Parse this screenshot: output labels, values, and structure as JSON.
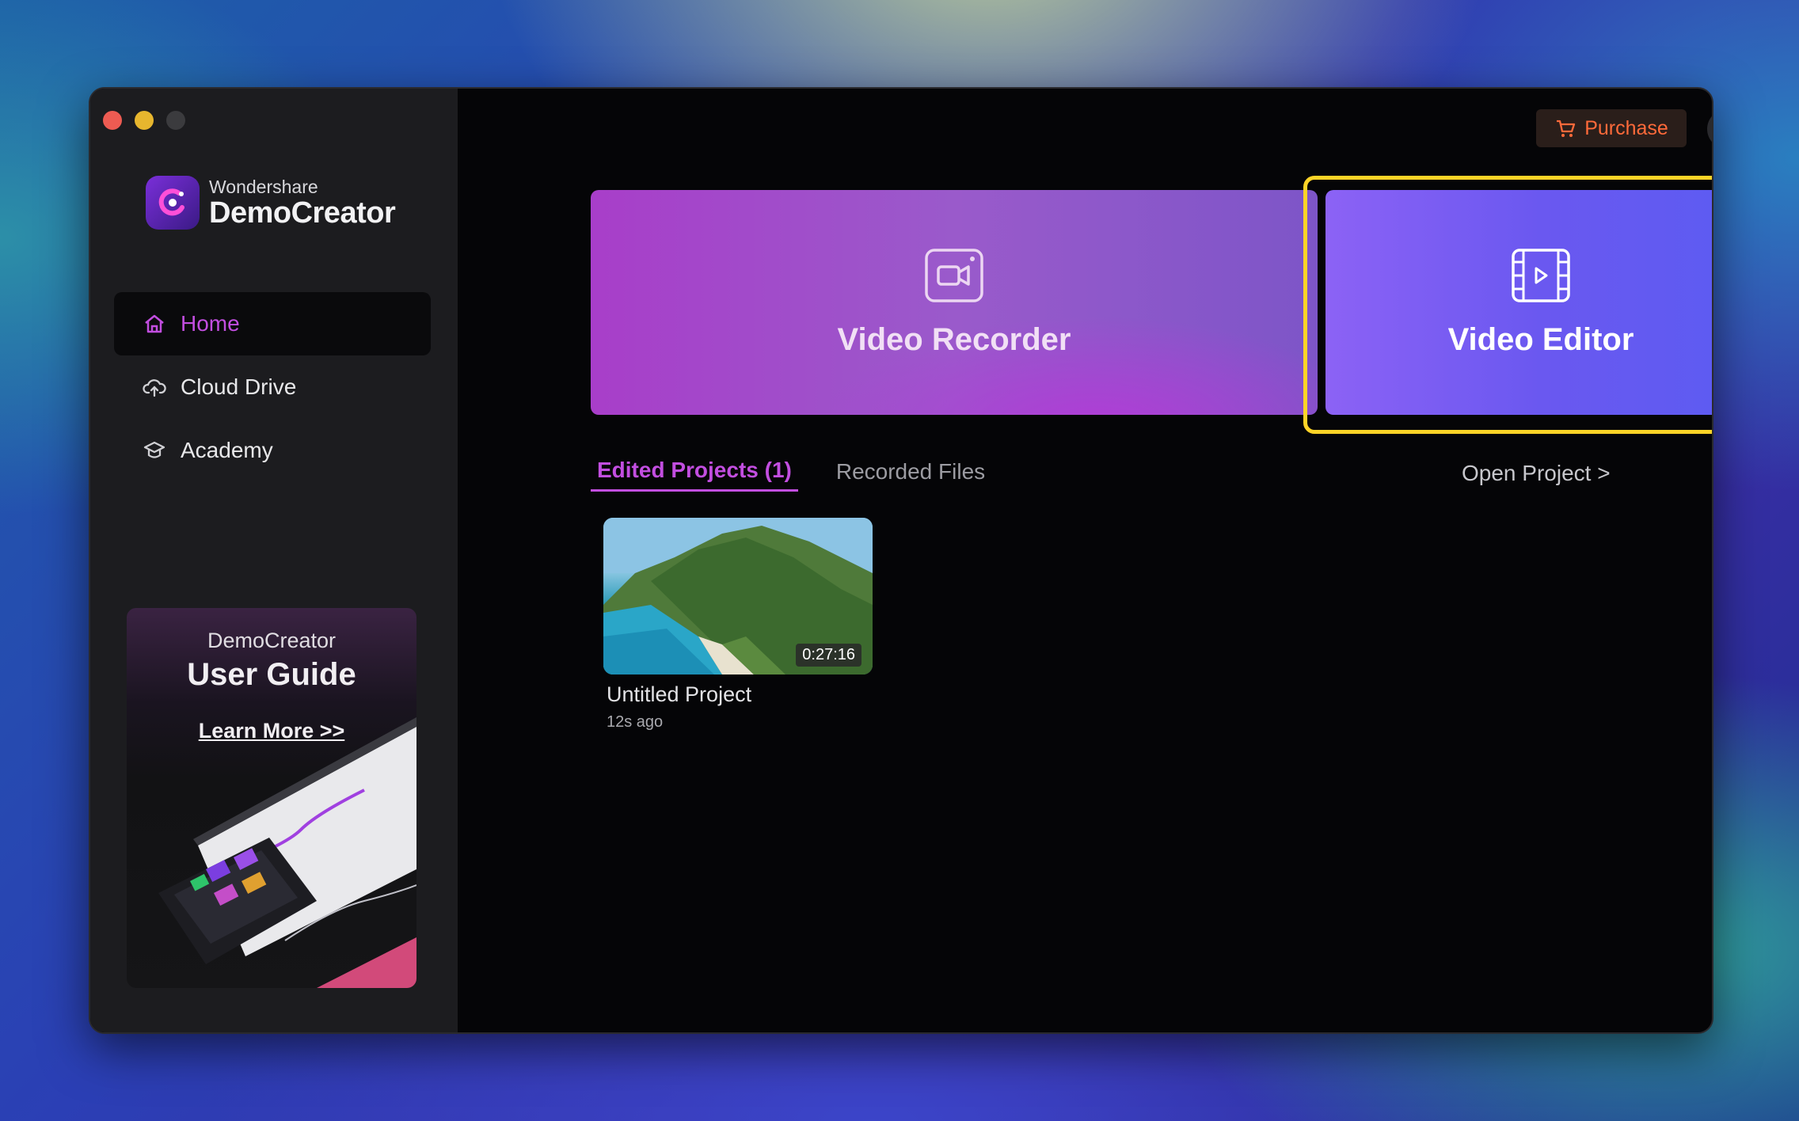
{
  "brand": {
    "company": "Wondershare",
    "product": "DemoCreator"
  },
  "sidebar": {
    "items": [
      {
        "label": "Home",
        "icon": "home-icon",
        "active": true
      },
      {
        "label": "Cloud Drive",
        "icon": "cloud-upload-icon",
        "active": false
      },
      {
        "label": "Academy",
        "icon": "graduation-cap-icon",
        "active": false
      }
    ],
    "guide": {
      "subtitle": "DemoCreator",
      "title": "User Guide",
      "link": "Learn More >>"
    }
  },
  "header": {
    "purchase_label": "Purchase"
  },
  "cards": {
    "recorder": {
      "label": "Video Recorder",
      "icon": "camera-icon"
    },
    "editor": {
      "label": "Video Editor",
      "icon": "film-play-icon",
      "highlighted": true
    }
  },
  "tabs": {
    "edited": "Edited Projects (1)",
    "recorded": "Recorded Files"
  },
  "open_project_label": "Open Project >",
  "projects": [
    {
      "title": "Untitled Project",
      "time": "12s ago",
      "duration": "0:27:16"
    }
  ],
  "colors": {
    "accent": "#c24ee0",
    "purchase": "#ff6a3a",
    "highlight": "#ffd427"
  }
}
